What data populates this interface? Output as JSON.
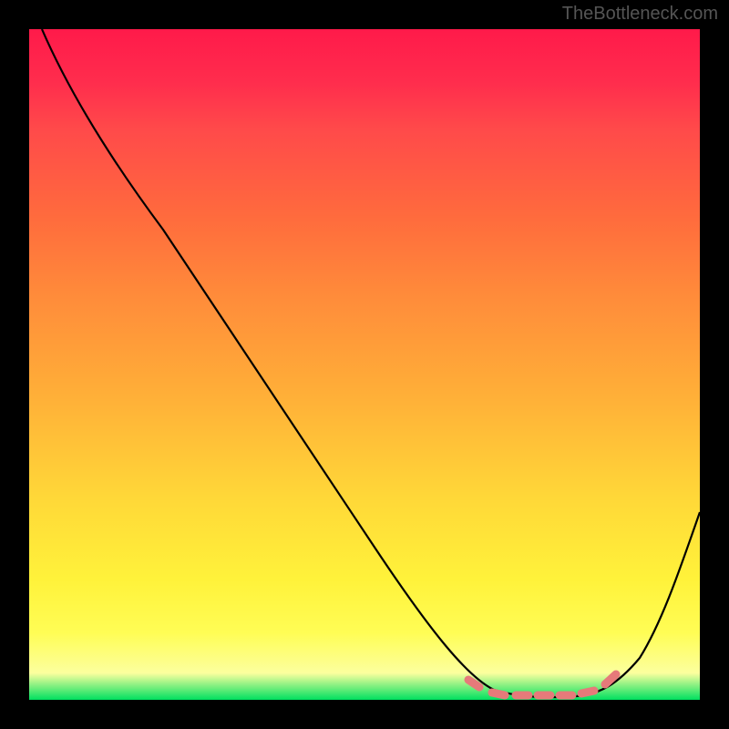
{
  "watermark": "TheBottleneck.com",
  "chart_data": {
    "type": "line",
    "title": "",
    "xlabel": "",
    "ylabel": "",
    "xlim": [
      0,
      100
    ],
    "ylim": [
      0,
      100
    ],
    "series": [
      {
        "name": "curve",
        "x": [
          2,
          10,
          20,
          30,
          40,
          50,
          60,
          68,
          72,
          76,
          80,
          84,
          88,
          92,
          96,
          100
        ],
        "values": [
          100,
          89,
          75,
          62,
          49,
          36,
          23,
          11,
          6,
          2,
          0.5,
          0.5,
          1.5,
          5,
          14,
          28
        ]
      }
    ],
    "highlight_region": {
      "x_start": 65,
      "x_end": 88,
      "color": "#e67a7a"
    },
    "gradient_stops": [
      {
        "pos": 0,
        "color": "#ff1a4a"
      },
      {
        "pos": 28,
        "color": "#ff6b3d"
      },
      {
        "pos": 55,
        "color": "#ffb038"
      },
      {
        "pos": 82,
        "color": "#fff23a"
      },
      {
        "pos": 96,
        "color": "#fcff9e"
      },
      {
        "pos": 100,
        "color": "#00e060"
      }
    ]
  }
}
